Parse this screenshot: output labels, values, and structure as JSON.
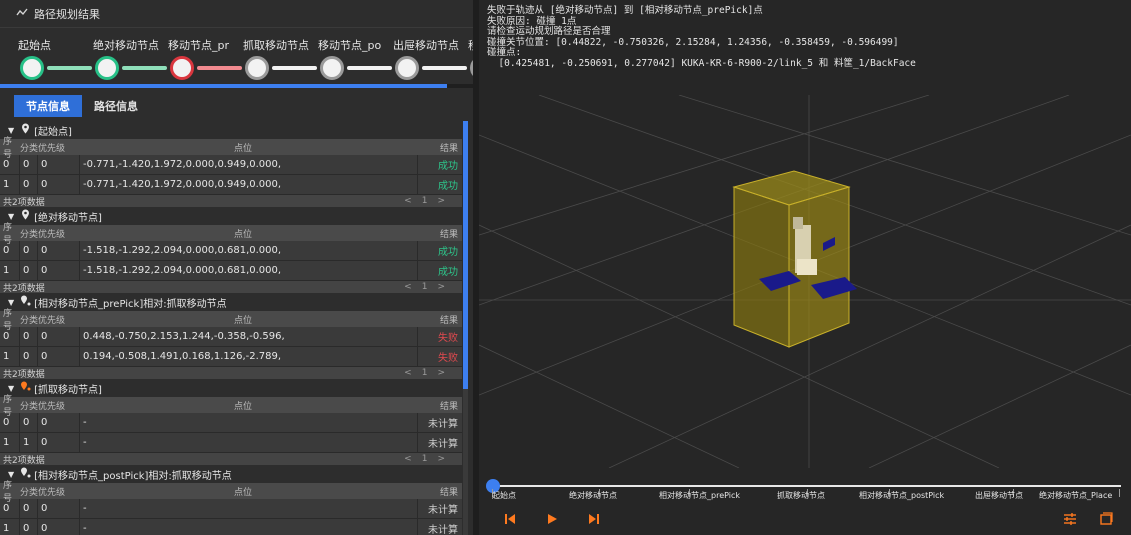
{
  "panel": {
    "title": "路径规划结果"
  },
  "stages": [
    {
      "label": "起始点",
      "status": "ok"
    },
    {
      "label": "绝对移动节点",
      "status": "ok"
    },
    {
      "label": "移动节点_pr",
      "status": "fail"
    },
    {
      "label": "抓取移动节点",
      "status": "pending"
    },
    {
      "label": "移动节点_po",
      "status": "pending"
    },
    {
      "label": "出屉移动节点",
      "status": "pending"
    },
    {
      "label": "移动",
      "status": "pending"
    }
  ],
  "tabs": {
    "node_info": "节点信息",
    "path_info": "路径信息"
  },
  "columns": {
    "idx": "序号",
    "group": "分类",
    "priority": "优先级",
    "position": "点位",
    "result": "结果"
  },
  "groups": [
    {
      "title": "[起始点]",
      "icon": "map-pin-icon",
      "rows": [
        {
          "idx": "0",
          "group": "0",
          "priority": "0",
          "position": "-0.771,-1.420,1.972,0.000,0.949,0.000,",
          "result": "成功",
          "status": "ok"
        },
        {
          "idx": "1",
          "group": "0",
          "priority": "0",
          "position": "-0.771,-1.420,1.972,0.000,0.949,0.000,",
          "result": "成功",
          "status": "ok"
        }
      ],
      "footer": "共2项数据",
      "page": "1"
    },
    {
      "title": "[绝对移动节点]",
      "icon": "map-pin-icon",
      "rows": [
        {
          "idx": "0",
          "group": "0",
          "priority": "0",
          "position": "-1.518,-1.292,2.094,0.000,0.681,0.000,",
          "result": "成功",
          "status": "ok"
        },
        {
          "idx": "1",
          "group": "0",
          "priority": "0",
          "position": "-1.518,-1.292,2.094,0.000,0.681,0.000,",
          "result": "成功",
          "status": "ok"
        }
      ],
      "footer": "共2项数据",
      "page": "1"
    },
    {
      "title": "[相对移动节点_prePick]相对:抓取移动节点",
      "icon": "relative-pin-icon",
      "rows": [
        {
          "idx": "0",
          "group": "0",
          "priority": "0",
          "position": "0.448,-0.750,2.153,1.244,-0.358,-0.596,",
          "result": "失败",
          "status": "fail"
        },
        {
          "idx": "1",
          "group": "0",
          "priority": "0",
          "position": "0.194,-0.508,1.491,0.168,1.126,-2.789,",
          "result": "失败",
          "status": "fail"
        }
      ],
      "footer": "共2项数据",
      "page": "1"
    },
    {
      "title": "[抓取移动节点]",
      "icon": "grab-pin-icon",
      "rows": [
        {
          "idx": "0",
          "group": "0",
          "priority": "0",
          "position": "-",
          "result": "未计算",
          "status": "none"
        },
        {
          "idx": "1",
          "group": "1",
          "priority": "0",
          "position": "-",
          "result": "未计算",
          "status": "none"
        }
      ],
      "footer": "共2项数据",
      "page": "1"
    },
    {
      "title": "[相对移动节点_postPick]相对:抓取移动节点",
      "icon": "relative-pin-icon",
      "rows": [
        {
          "idx": "0",
          "group": "0",
          "priority": "0",
          "position": "-",
          "result": "未计算",
          "status": "none"
        },
        {
          "idx": "1",
          "group": "0",
          "priority": "0",
          "position": "-",
          "result": "未计算",
          "status": "none"
        }
      ],
      "footer": "共2项数据",
      "page": "1"
    }
  ],
  "error": {
    "lines": [
      "失败于轨迹从 [绝对移动节点] 到 [相对移动节点_prePick]点",
      "失败原因: 碰撞 1点",
      "请检查运动规划路径是否合理",
      "碰撞关节位置: [0.44822, -0.750326, 2.15284, 1.24356, -0.358459, -0.596499]",
      "碰撞点:",
      "  [0.425481, -0.250691, 0.277042] KUKA-KR-6-R900-2/link_5 和 料筐_1/BackFace"
    ]
  },
  "timeline": {
    "progress": 0,
    "markers": [
      "起始点",
      "绝对移动节点",
      "相对移动节点_prePick",
      "抓取移动节点",
      "相对移动节点_postPick",
      "出屉移动节点",
      "绝对移动节点_Place"
    ]
  },
  "icons": {
    "header": "route-icon",
    "first": "skip-to-start-icon",
    "play": "play-icon",
    "last": "skip-to-end-icon",
    "settings": "sliders-icon",
    "window": "window-icon"
  },
  "colors": {
    "accent": "#2f6fd8",
    "success": "#2ec48a",
    "fail": "#e04a4f",
    "control": "#ff7a1f"
  }
}
